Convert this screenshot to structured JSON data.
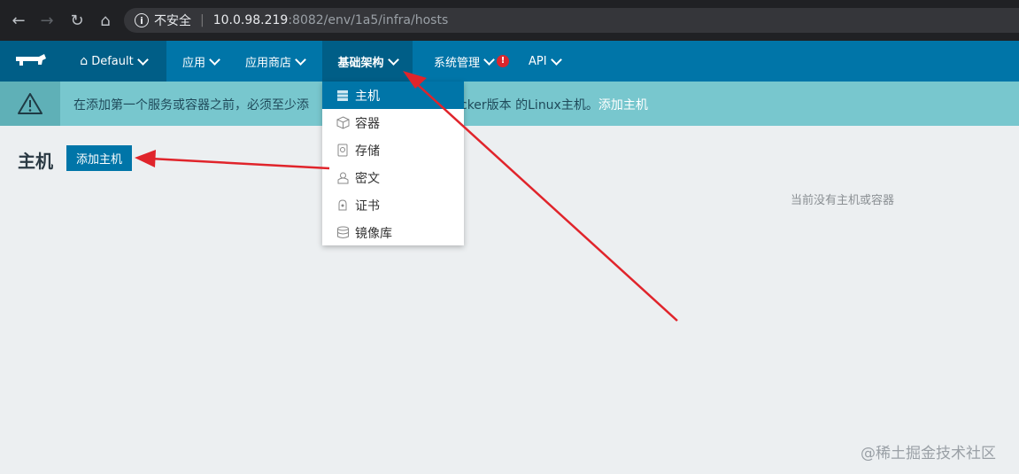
{
  "browser": {
    "back_icon": "back-arrow-icon",
    "security_label": "不安全",
    "url_host": "10.0.98.219",
    "url_rest": ":8082/env/1a5/infra/hosts"
  },
  "header": {
    "environment": "Default",
    "nav": {
      "apps": "应用",
      "catalog": "应用商店",
      "infra": "基础架构",
      "admin": "系统管理",
      "admin_badge": "!",
      "api": "API"
    }
  },
  "banner": {
    "text_start": "在添加第一个服务或容器之前，必须至少添",
    "text_end": "cker版本 的Linux主机。",
    "link": "添加主机"
  },
  "dropdown": {
    "items": [
      {
        "label": "主机",
        "icon": "host-icon"
      },
      {
        "label": "容器",
        "icon": "container-icon"
      },
      {
        "label": "存储",
        "icon": "storage-icon"
      },
      {
        "label": "密文",
        "icon": "secret-icon"
      },
      {
        "label": "证书",
        "icon": "certificate-icon"
      },
      {
        "label": "镜像库",
        "icon": "registry-icon"
      }
    ]
  },
  "page": {
    "title": "主机",
    "add_button": "添加主机",
    "empty_message": "当前没有主机或容器"
  },
  "watermark": "@稀土掘金技术社区",
  "colors": {
    "primary": "#0075a8",
    "primary_dark": "#005e87",
    "banner": "#78c7ce",
    "annotation_arrow": "#e0242b"
  }
}
